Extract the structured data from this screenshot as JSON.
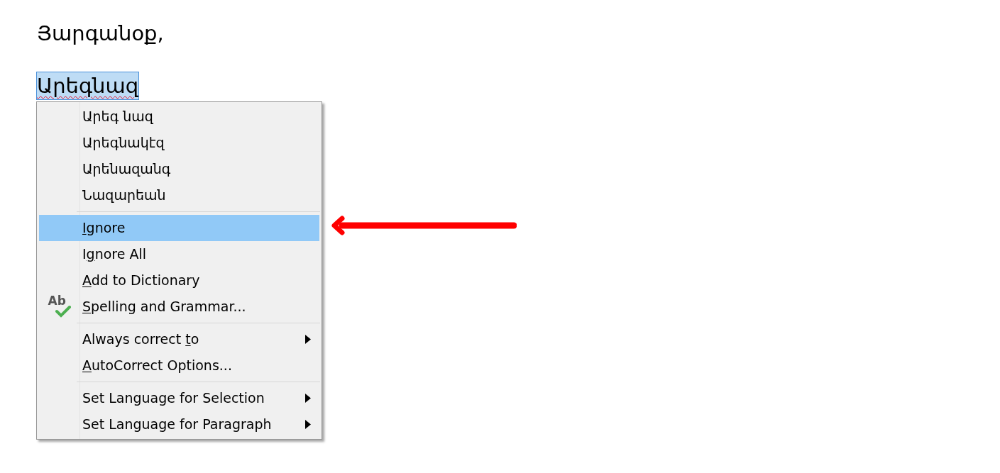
{
  "document": {
    "lines": [
      {
        "text": "Յարգանօք,",
        "selected": false,
        "misspelled": false
      },
      {
        "text": "Արեգնազ",
        "selected": true,
        "misspelled": true
      }
    ]
  },
  "context_menu": {
    "sections": [
      {
        "items": [
          {
            "kind": "text",
            "pre": "Արեգ նազ",
            "selected": false,
            "submenu": false
          },
          {
            "kind": "text",
            "pre": "Արեգնակէզ",
            "selected": false,
            "submenu": false
          },
          {
            "kind": "text",
            "pre": "Արենազանգ",
            "selected": false,
            "submenu": false
          },
          {
            "kind": "text",
            "pre": "Նազարեան",
            "selected": false,
            "submenu": false
          }
        ]
      },
      {
        "items": [
          {
            "kind": "text",
            "key": "I",
            "post": "gnore",
            "selected": true,
            "submenu": false
          },
          {
            "kind": "text",
            "pre": "I",
            "key": "g",
            "post": "nore All",
            "selected": false,
            "submenu": false
          },
          {
            "kind": "text",
            "key": "A",
            "post": "dd to Dictionary",
            "selected": false,
            "submenu": false
          },
          {
            "kind": "with-icon",
            "key": "S",
            "post": "pelling and Grammar...",
            "selected": false,
            "submenu": false,
            "icon_text": "Ab"
          }
        ]
      },
      {
        "items": [
          {
            "kind": "text",
            "pre": "Always correct ",
            "key": "t",
            "post": "o",
            "selected": false,
            "submenu": true
          },
          {
            "kind": "text",
            "key": "A",
            "post": "utoCorrect Options...",
            "selected": false,
            "submenu": false
          }
        ]
      },
      {
        "items": [
          {
            "kind": "text",
            "pre": "Set Language for Selection",
            "selected": false,
            "submenu": true
          },
          {
            "kind": "text",
            "pre": "Set Language for Paragraph",
            "selected": false,
            "submenu": true
          }
        ]
      }
    ]
  },
  "callout_arrow": {
    "kind": "arrow"
  }
}
